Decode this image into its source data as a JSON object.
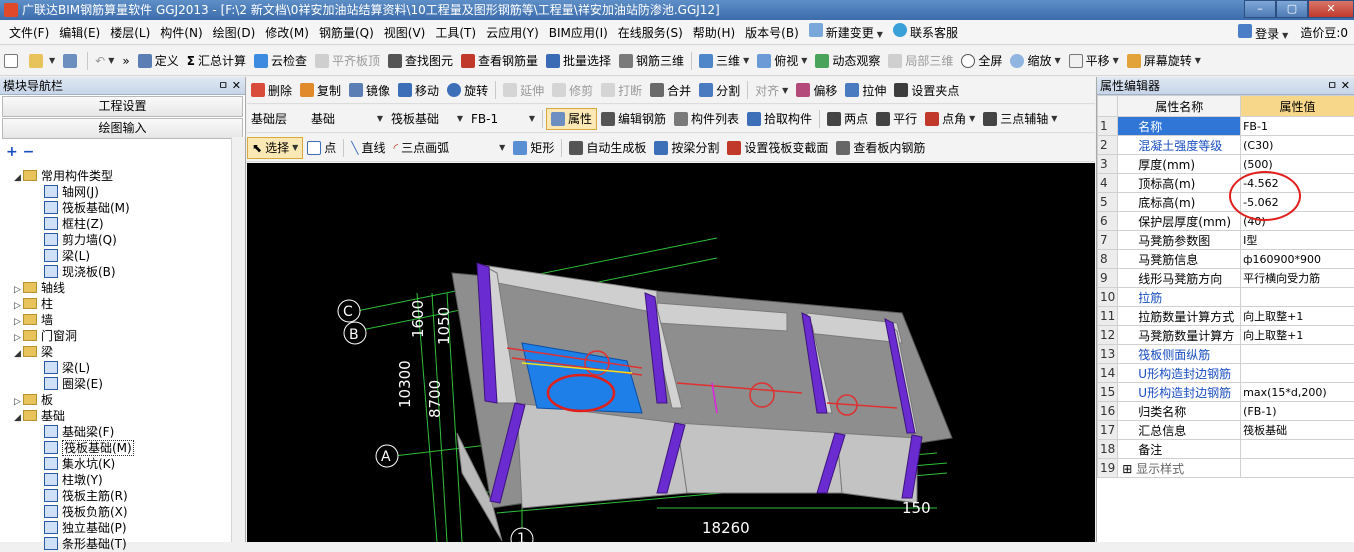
{
  "window": {
    "title": "广联达BIM钢筋算量软件 GGJ2013 - [F:\\2 新文档\\0祥安加油站结算资料\\10工程量及图形钢筋等\\工程量\\祥安加油站防渗池.GGJ12]",
    "min": "–",
    "max": "▢",
    "close": "✕"
  },
  "menu": {
    "items": [
      "文件(F)",
      "编辑(E)",
      "楼层(L)",
      "构件(N)",
      "绘图(D)",
      "修改(M)",
      "钢筋量(Q)",
      "视图(V)",
      "工具(T)",
      "云应用(Y)",
      "BIM应用(I)",
      "在线服务(S)",
      "帮助(H)",
      "版本号(B)",
      "新建变更",
      "联系客服"
    ],
    "right": [
      "登录",
      "造价豆:0"
    ]
  },
  "toolbar1": [
    "定义",
    "汇总计算",
    "云检查",
    "平齐板顶",
    "查找图元",
    "查看钢筋量",
    "批量选择",
    "钢筋三维",
    "三维",
    "俯视",
    "动态观察",
    "局部三维",
    "全屏",
    "缩放",
    "平移",
    "屏幕旋转"
  ],
  "toolbar2": [
    "删除",
    "复制",
    "镜像",
    "移动",
    "旋转",
    "延伸",
    "修剪",
    "打断",
    "合并",
    "分割",
    "对齐",
    "偏移",
    "拉伸",
    "设置夹点"
  ],
  "toolbar3": {
    "floor": "基础层",
    "category": "基础",
    "type": "筏板基础",
    "member": "FB-1",
    "items": [
      "属性",
      "编辑钢筋",
      "构件列表",
      "拾取构件",
      "两点",
      "平行",
      "点角",
      "三点辅轴"
    ]
  },
  "toolbar4": [
    "选择",
    "点",
    "直线",
    "三点画弧",
    "矩形",
    "自动生成板",
    "按梁分割",
    "设置筏板变截面",
    "查看板内钢筋"
  ],
  "left_panel": {
    "title": "模块导航栏",
    "pin": "ㅁ ✕",
    "buttons": [
      "工程设置",
      "绘图输入"
    ],
    "tree": [
      {
        "level": 0,
        "label": "常用构件类型",
        "expanded": true,
        "folder": true
      },
      {
        "level": 1,
        "label": "轴网(J)"
      },
      {
        "level": 1,
        "label": "筏板基础(M)"
      },
      {
        "level": 1,
        "label": "框柱(Z)"
      },
      {
        "level": 1,
        "label": "剪力墙(Q)"
      },
      {
        "level": 1,
        "label": "梁(L)"
      },
      {
        "level": 1,
        "label": "现浇板(B)"
      },
      {
        "level": 0,
        "label": "轴线",
        "folder": true
      },
      {
        "level": 0,
        "label": "柱",
        "folder": true
      },
      {
        "level": 0,
        "label": "墙",
        "folder": true
      },
      {
        "level": 0,
        "label": "门窗洞",
        "folder": true
      },
      {
        "level": 0,
        "label": "梁",
        "expanded": true,
        "folder": true
      },
      {
        "level": 1,
        "label": "梁(L)"
      },
      {
        "level": 1,
        "label": "圈梁(E)"
      },
      {
        "level": 0,
        "label": "板",
        "folder": true
      },
      {
        "level": 0,
        "label": "基础",
        "expanded": true,
        "folder": true
      },
      {
        "level": 1,
        "label": "基础梁(F)"
      },
      {
        "level": 1,
        "label": "筏板基础(M)",
        "selected": true
      },
      {
        "level": 1,
        "label": "集水坑(K)"
      },
      {
        "level": 1,
        "label": "柱墩(Y)"
      },
      {
        "level": 1,
        "label": "筏板主筋(R)"
      },
      {
        "level": 1,
        "label": "筏板负筋(X)"
      },
      {
        "level": 1,
        "label": "独立基础(P)"
      },
      {
        "level": 1,
        "label": "条形基础(T)"
      }
    ]
  },
  "right_panel": {
    "title": "属性编辑器",
    "pin": "ㅁ ✕",
    "header": {
      "name": "属性名称",
      "value": "属性值"
    },
    "rows": [
      {
        "n": "1",
        "name": "名称",
        "value": "FB-1",
        "blue": false
      },
      {
        "n": "2",
        "name": "混凝土强度等级",
        "value": "(C30)",
        "blue": true
      },
      {
        "n": "3",
        "name": "厚度(mm)",
        "value": "(500)",
        "blue": false
      },
      {
        "n": "4",
        "name": "顶标高(m)",
        "value": "-4.562",
        "blue": false
      },
      {
        "n": "5",
        "name": "底标高(m)",
        "value": "-5.062",
        "blue": false
      },
      {
        "n": "6",
        "name": "保护层厚度(mm)",
        "value": "(40)",
        "blue": false
      },
      {
        "n": "7",
        "name": "马凳筋参数图",
        "value": "Ⅰ型",
        "blue": false
      },
      {
        "n": "8",
        "name": "马凳筋信息",
        "value": "ф160900*900",
        "blue": false
      },
      {
        "n": "9",
        "name": "线形马凳筋方向",
        "value": "平行横向受力筋",
        "blue": false
      },
      {
        "n": "10",
        "name": "拉筋",
        "value": "",
        "blue": true
      },
      {
        "n": "11",
        "name": "拉筋数量计算方式",
        "value": "向上取整+1",
        "blue": false
      },
      {
        "n": "12",
        "name": "马凳筋数量计算方",
        "value": "向上取整+1",
        "blue": false
      },
      {
        "n": "13",
        "name": "筏板侧面纵筋",
        "value": "",
        "blue": true
      },
      {
        "n": "14",
        "name": "U形构造封边钢筋",
        "value": "",
        "blue": true
      },
      {
        "n": "15",
        "name": "U形构造封边钢筋",
        "value": "max(15*d,200)",
        "blue": true
      },
      {
        "n": "16",
        "name": "归类名称",
        "value": "(FB-1)",
        "blue": false
      },
      {
        "n": "17",
        "name": "汇总信息",
        "value": "筏板基础",
        "blue": false
      },
      {
        "n": "18",
        "name": "备注",
        "value": "",
        "blue": false
      },
      {
        "n": "19",
        "name": "显示样式",
        "value": "",
        "blue": false,
        "expand": true
      }
    ]
  },
  "canvas": {
    "axis_labels": [
      "C",
      "B",
      "A",
      "1"
    ],
    "dims": [
      "1600",
      "1050",
      "10300",
      "8700",
      "18260",
      "150"
    ]
  },
  "colors": {
    "accent": "#2f76d6",
    "highlight": "#f7d88a",
    "annotation": "#e0201b",
    "wall": "#bdbdbd",
    "column": "#6a2bd1"
  }
}
